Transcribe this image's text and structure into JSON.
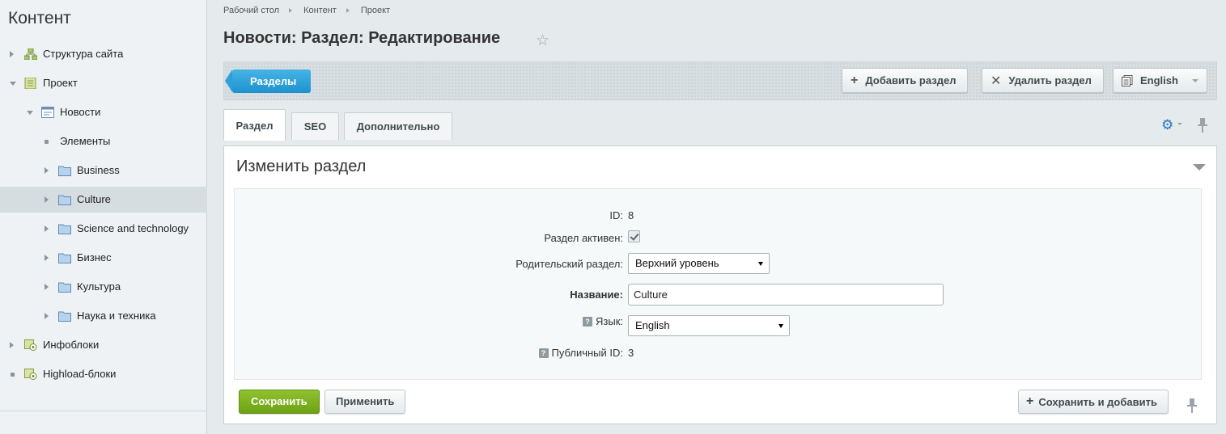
{
  "sidebar": {
    "title": "Контент",
    "items": [
      {
        "label": "Структура сайта"
      },
      {
        "label": "Проект"
      },
      {
        "label": "Новости"
      },
      {
        "label": "Элементы"
      },
      {
        "label": "Business"
      },
      {
        "label": "Culture"
      },
      {
        "label": "Science and technology"
      },
      {
        "label": "Бизнес"
      },
      {
        "label": "Культура"
      },
      {
        "label": "Наука и техника"
      },
      {
        "label": "Инфоблоки"
      },
      {
        "label": "Highload-блоки"
      }
    ]
  },
  "breadcrumb": [
    "Рабочий стол",
    "Контент",
    "Проект"
  ],
  "page_title": "Новости: Раздел: Редактирование",
  "toolbar": {
    "sections_label": "Разделы",
    "add_section_label": "Добавить раздел",
    "delete_section_label": "Удалить раздел",
    "language_label": "English"
  },
  "tabs": [
    {
      "label": "Раздел"
    },
    {
      "label": "SEO"
    },
    {
      "label": "Дополнительно"
    }
  ],
  "panel": {
    "title": "Изменить раздел"
  },
  "form": {
    "id_label": "ID:",
    "id_value": "8",
    "active_label": "Раздел активен:",
    "active_checked": true,
    "parent_label": "Родительский раздел:",
    "parent_value": "Верхний уровень",
    "name_label": "Название:",
    "name_value": "Culture",
    "lang_label": "Язык:",
    "lang_value": "English",
    "public_id_label": "Публичный ID:",
    "public_id_value": "3",
    "help_glyph": "?"
  },
  "actions": {
    "save_label": "Сохранить",
    "apply_label": "Применить",
    "save_add_label": "Сохранить и добавить"
  },
  "colors": {
    "accent_blue": "#1e92cf",
    "save_green": "#7ab121",
    "gear_blue": "#2077c4"
  }
}
